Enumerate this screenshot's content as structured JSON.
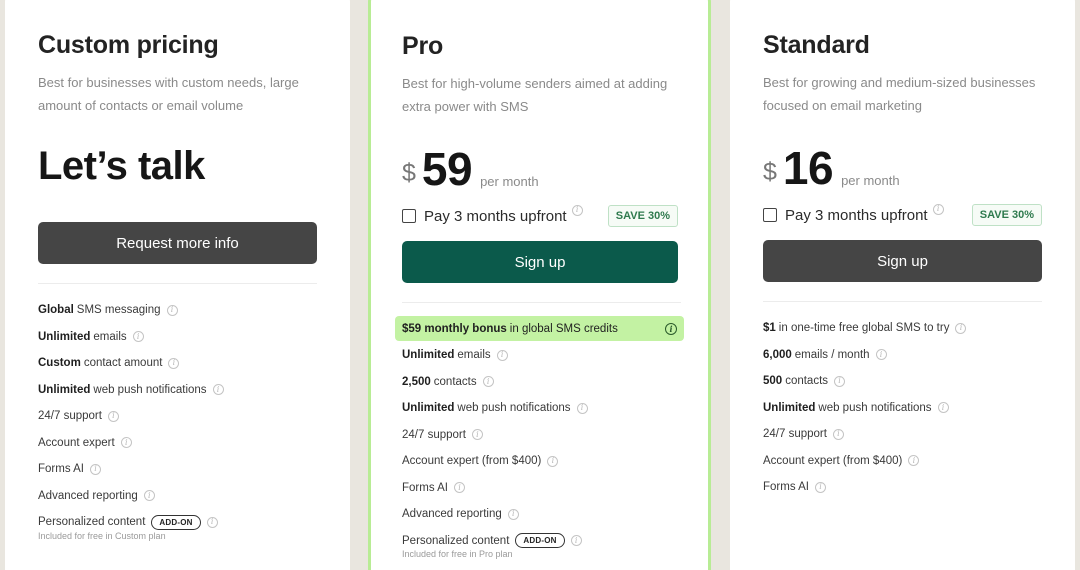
{
  "plans": {
    "custom": {
      "title": "Custom pricing",
      "description": "Best for businesses with custom needs, large amount of contacts or email volume",
      "headline": "Let’s talk",
      "cta": "Request more info",
      "features": [
        {
          "bold": "Global",
          "text": "SMS messaging"
        },
        {
          "bold": "Unlimited",
          "text": "emails"
        },
        {
          "bold": "Custom",
          "text": "contact amount"
        },
        {
          "bold": "Unlimited",
          "text": "web push notifications"
        },
        {
          "bold": "",
          "text": "24/7 support"
        },
        {
          "bold": "",
          "text": "Account expert"
        },
        {
          "bold": "",
          "text": "Forms AI"
        },
        {
          "bold": "",
          "text": "Advanced reporting"
        },
        {
          "bold": "",
          "text": "Personalized content"
        }
      ],
      "addon_label": "ADD-ON",
      "addon_note": "Included for free in Custom plan"
    },
    "pro": {
      "title": "Pro",
      "description": "Best for high-volume senders aimed at adding extra power with SMS",
      "currency": "$",
      "amount": "59",
      "per": "per month",
      "upfront_label": "Pay 3 months upfront",
      "save_badge": "SAVE 30%",
      "cta": "Sign up",
      "bonus": {
        "bold": "$59 monthly bonus",
        "text": "in global SMS credits"
      },
      "features": [
        {
          "bold": "Unlimited",
          "text": "emails"
        },
        {
          "bold": "2,500",
          "text": "contacts"
        },
        {
          "bold": "Unlimited",
          "text": "web push notifications"
        },
        {
          "bold": "",
          "text": "24/7 support"
        },
        {
          "bold": "",
          "text": "Account expert (from $400)"
        },
        {
          "bold": "",
          "text": "Forms AI"
        },
        {
          "bold": "",
          "text": "Advanced reporting"
        },
        {
          "bold": "",
          "text": "Personalized content"
        }
      ],
      "addon_label": "ADD-ON",
      "addon_note": "Included for free in Pro plan"
    },
    "standard": {
      "title": "Standard",
      "description": "Best for growing and medium-sized businesses focused on email marketing",
      "currency": "$",
      "amount": "16",
      "per": "per month",
      "upfront_label": "Pay 3 months upfront",
      "save_badge": "SAVE 30%",
      "cta": "Sign up",
      "features": [
        {
          "bold": "$1",
          "text": "in one-time free global SMS to try"
        },
        {
          "bold": "6,000",
          "text": "emails / month"
        },
        {
          "bold": "500",
          "text": "contacts"
        },
        {
          "bold": "Unlimited",
          "text": "web push notifications"
        },
        {
          "bold": "",
          "text": "24/7 support"
        },
        {
          "bold": "",
          "text": "Account expert (from $400)"
        },
        {
          "bold": "",
          "text": "Forms AI"
        }
      ]
    }
  },
  "colors": {
    "pro_cta": "#0b5a4b",
    "dark_cta": "#454545",
    "bonus_highlight": "#c3f2a3",
    "pro_border": "#b8ec95"
  },
  "icons": {
    "info": "i"
  }
}
